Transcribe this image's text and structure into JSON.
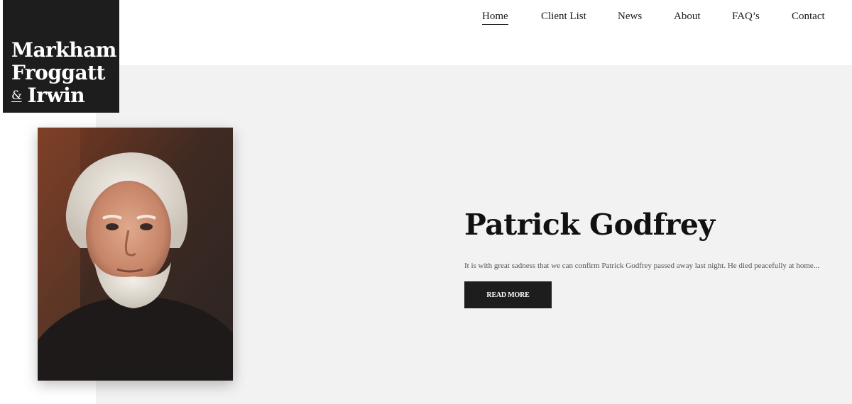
{
  "logo": {
    "line1": "Markham",
    "line2": "Froggatt",
    "ampersand": "&",
    "line3": "Irwin"
  },
  "nav": {
    "items": [
      {
        "label": "Home",
        "active": true
      },
      {
        "label": "Client List",
        "active": false
      },
      {
        "label": "News",
        "active": false
      },
      {
        "label": "About",
        "active": false
      },
      {
        "label": "FAQ’s",
        "active": false
      },
      {
        "label": "Contact",
        "active": false
      }
    ]
  },
  "feature": {
    "title": "Patrick Godfrey",
    "excerpt": "It is with great sadness that we can confirm Patrick Godfrey passed away last night. He died peacefully at home...",
    "button_label": "READ MORE"
  },
  "colors": {
    "logo_bg": "#1d1d1d",
    "hero_bg": "#f2f2f2",
    "button_bg": "#1d1d1d"
  }
}
